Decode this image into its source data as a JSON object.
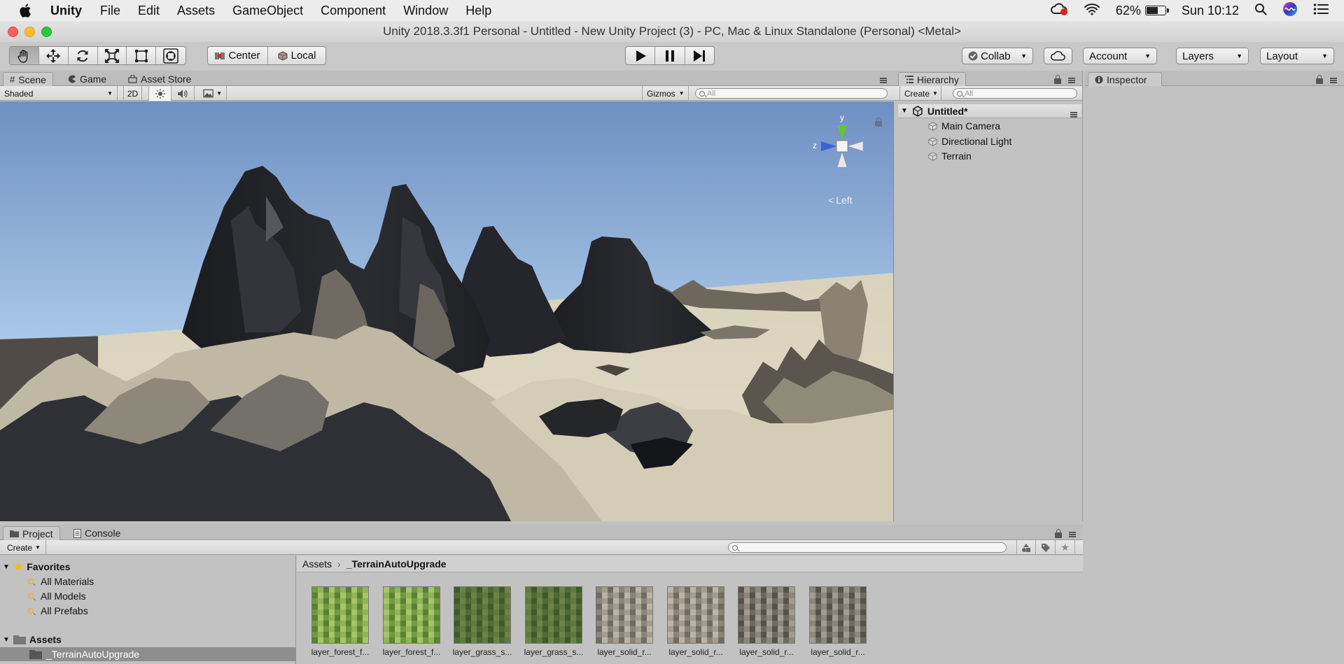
{
  "menubar": {
    "app_name": "Unity",
    "items": [
      "File",
      "Edit",
      "Assets",
      "GameObject",
      "Component",
      "Window",
      "Help"
    ],
    "battery": "62%",
    "battery_level": 0.62,
    "clock": "Sun 10:12"
  },
  "window": {
    "title": "Unity 2018.3.3f1 Personal - Untitled - New Unity Project (3) - PC, Mac & Linux Standalone (Personal) <Metal>"
  },
  "toolbar": {
    "pivot_label": "Center",
    "space_label": "Local",
    "collab_label": "Collab",
    "account_label": "Account",
    "layers_label": "Layers",
    "layout_label": "Layout"
  },
  "scene_panel": {
    "tabs": [
      "Scene",
      "Game",
      "Asset Store"
    ],
    "shading_mode": "Shaded",
    "mode_2d": "2D",
    "gizmos_label": "Gizmos",
    "search_placeholder": "All",
    "gizmo_axes": {
      "y": "y",
      "z": "z"
    },
    "view_label": "Left"
  },
  "hierarchy": {
    "tab": "Hierarchy",
    "create_label": "Create",
    "search_placeholder": "All",
    "scene_name": "Untitled*",
    "items": [
      "Main Camera",
      "Directional Light",
      "Terrain"
    ]
  },
  "inspector": {
    "tab": "Inspector"
  },
  "project_panel": {
    "tabs": [
      "Project",
      "Console"
    ],
    "create_label": "Create",
    "favorites_label": "Favorites",
    "favorites": [
      "All Materials",
      "All Models",
      "All Prefabs"
    ],
    "assets_label": "Assets",
    "folders": [
      "_TerrainAutoUpgrade"
    ],
    "breadcrumb": [
      "Assets",
      "_TerrainAutoUpgrade"
    ],
    "assets": [
      {
        "name": "layer_forest_f...",
        "kind": "grass"
      },
      {
        "name": "layer_forest_f...",
        "kind": "grass"
      },
      {
        "name": "layer_grass_s...",
        "kind": "darkgrass"
      },
      {
        "name": "layer_grass_s...",
        "kind": "darkgrass"
      },
      {
        "name": "layer_solid_r...",
        "kind": "rock"
      },
      {
        "name": "layer_solid_r...",
        "kind": "rock"
      },
      {
        "name": "layer_solid_r...",
        "kind": "darkrock"
      },
      {
        "name": "layer_solid_r...",
        "kind": "darkrock"
      }
    ]
  },
  "colors": {
    "sky_top": "#6e8fc2",
    "sky_horizon": "#e9f3fb",
    "ground": "#d9d2bd",
    "accent_green": "#6cc23a",
    "accent_blue": "#3a63d8"
  }
}
